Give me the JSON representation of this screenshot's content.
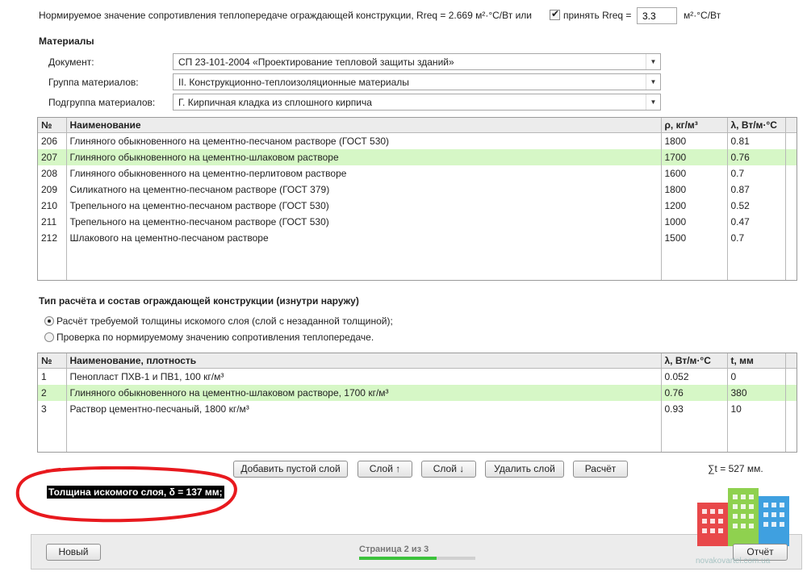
{
  "norm": {
    "text": "Нормируемое значение сопротивления теплопередаче ограждающей конструкции, Rreq = 2.669 м²·°С/Вт или",
    "accept_checked": true,
    "accept_label": "принять Rreq =",
    "value": "3.3",
    "unit": "м²·°С/Вт"
  },
  "materials": {
    "title": "Материалы",
    "document": {
      "label": "Документ:",
      "value": "СП 23-101-2004 «Проектирование тепловой защиты зданий»"
    },
    "group": {
      "label": "Группа материалов:",
      "value": "II. Конструкционно-теплоизоляционные материалы"
    },
    "subgroup": {
      "label": "Подгруппа материалов:",
      "value": "Г. Кирпичная кладка из сплошного кирпича"
    },
    "table": {
      "headers": [
        "№",
        "Наименование",
        "ρ, кг/м³",
        "λ, Вт/м·°С"
      ],
      "rows": [
        [
          "206",
          "Глиняного обыкновенного на цементно-песчаном растворе (ГОСТ 530)",
          "1800",
          "0.81"
        ],
        [
          "207",
          "Глиняного обыкновенного на цементно-шлаковом растворе",
          "1700",
          "0.76"
        ],
        [
          "208",
          "Глиняного обыкновенного на цементно-перлитовом растворе",
          "1600",
          "0.7"
        ],
        [
          "209",
          "Силикатного на цементно-песчаном растворе (ГОСТ 379)",
          "1800",
          "0.87"
        ],
        [
          "210",
          "Трепельного на цементно-песчаном растворе (ГОСТ 530)",
          "1200",
          "0.52"
        ],
        [
          "211",
          "Трепельного на цементно-песчаном растворе (ГОСТ 530)",
          "1000",
          "0.47"
        ],
        [
          "212",
          "Шлакового на цементно-песчаном растворе",
          "1500",
          "0.7"
        ]
      ],
      "selected_row": 1
    }
  },
  "calc": {
    "title": "Тип расчёта и состав ограждающей конструкции (изнутри наружу)",
    "option1": "Расчёт требуемой толщины искомого слоя (слой с незаданной толщиной);",
    "option2": "Проверка по нормируемому значению сопротивления теплопередаче.",
    "selected_option": 1,
    "table": {
      "headers": [
        "№",
        "Наименование, плотность",
        "λ, Вт/м·°С",
        "t, мм"
      ],
      "rows": [
        [
          "1",
          "Пенопласт ПХВ-1 и ПВ1, 100 кг/м³",
          "0.052",
          "0"
        ],
        [
          "2",
          "Глиняного обыкновенного на цементно-шлаковом растворе, 1700 кг/м³",
          "0.76",
          "380"
        ],
        [
          "3",
          "Раствор цементно-песчаный, 1800 кг/м³",
          "0.93",
          "10"
        ]
      ],
      "selected_row": 1
    }
  },
  "buttons": {
    "add_empty": "Добавить пустой слой",
    "layer_up": "Слой ↑",
    "layer_down": "Слой ↓",
    "delete_layer": "Удалить слой",
    "calculate": "Расчёт"
  },
  "sum_t": "∑t = 527 мм.",
  "result": "Толщина искомого слоя, δ = 137 мм;",
  "footer": {
    "new_button": "Новый",
    "page_text": "Страница 2 из 3",
    "progress": 0.667,
    "report_button": "Отчёт",
    "watermark": "novakovartel.com.ua"
  },
  "colors": {
    "selected_row": "#d6f7c6",
    "progress": "#3cc23c",
    "annotation": "#e8191e",
    "logo_red": "#e8484a",
    "logo_green": "#8fd14f",
    "logo_blue": "#3fa0e0"
  }
}
